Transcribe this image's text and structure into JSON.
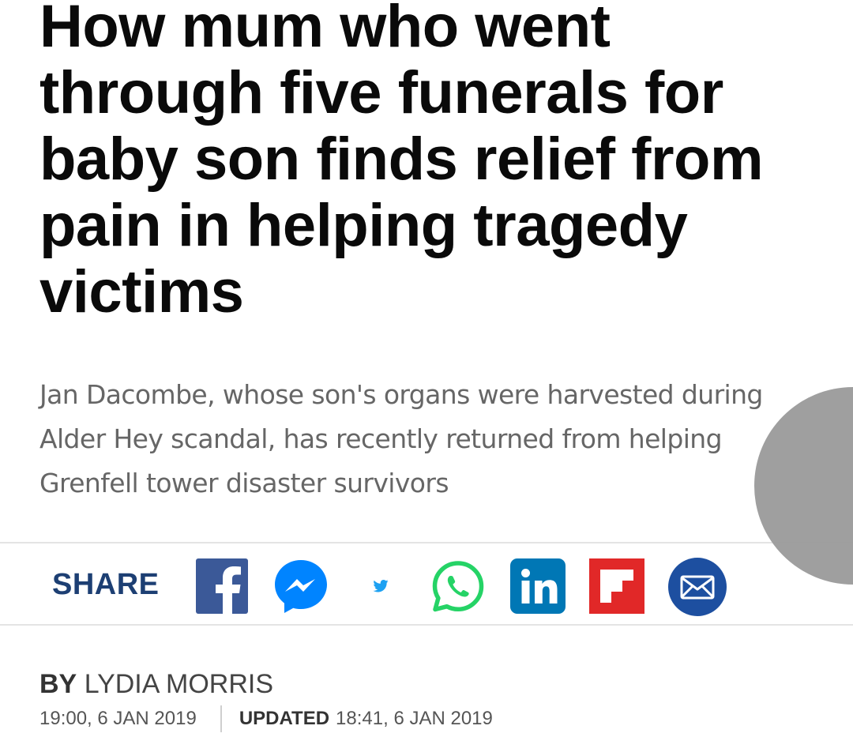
{
  "article": {
    "headline_lines": [
      "How mum who went",
      "through five funerals for",
      "baby son finds relief from",
      "pain in helping tragedy",
      "victims"
    ],
    "standfirst_lines": [
      "Jan Dacombe, whose son's organs were harvested during",
      "Alder Hey scandal, has recently returned from helping",
      "Grenfell tower disaster survivors"
    ]
  },
  "share": {
    "label": "SHARE",
    "icons": [
      {
        "name": "facebook-icon",
        "color": "#3b5998"
      },
      {
        "name": "messenger-icon",
        "color": "#0084ff"
      },
      {
        "name": "twitter-icon",
        "color": "#1da1f2"
      },
      {
        "name": "whatsapp-icon",
        "color": "#25d366"
      },
      {
        "name": "linkedin-icon",
        "color": "#0077b5"
      },
      {
        "name": "flipboard-icon",
        "color": "#e12828"
      },
      {
        "name": "email-icon",
        "color": "#1d4fa0"
      }
    ]
  },
  "byline": {
    "by_label": "BY",
    "author": "LYDIA MORRIS",
    "published": "19:00, 6 JAN 2019",
    "updated_label": "UPDATED",
    "updated": "18:41, 6 JAN 2019"
  },
  "overlay": {
    "color": "#9a9a9a"
  }
}
